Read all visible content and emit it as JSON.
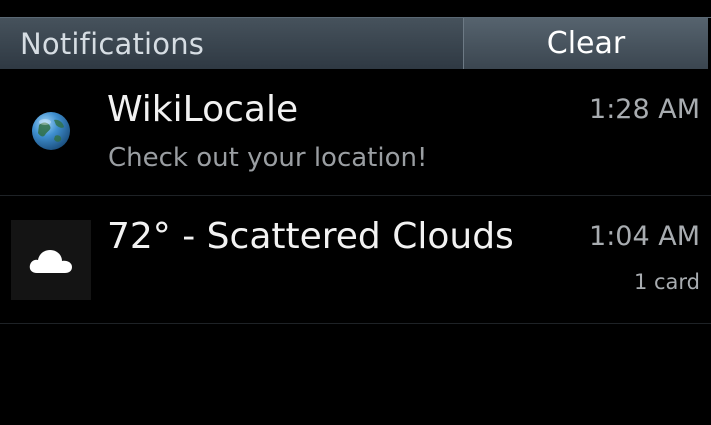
{
  "header": {
    "title": "Notifications",
    "clear_label": "Clear"
  },
  "notifications": [
    {
      "icon": "globe-icon",
      "title": "WikiLocale",
      "subtitle": "Check out your location!",
      "time": "1:28 AM"
    },
    {
      "icon": "cloud-icon",
      "title": "72° - Scattered Clouds",
      "time": "1:04 AM",
      "count": "1 card"
    }
  ],
  "colors": {
    "background": "#000000",
    "header_gradient_top": "#46525c",
    "header_gradient_bottom": "#2f3943",
    "title_text": "#f2f2f2",
    "secondary_text": "#9a9ea2",
    "globe_blue": "#4a9ed8"
  }
}
